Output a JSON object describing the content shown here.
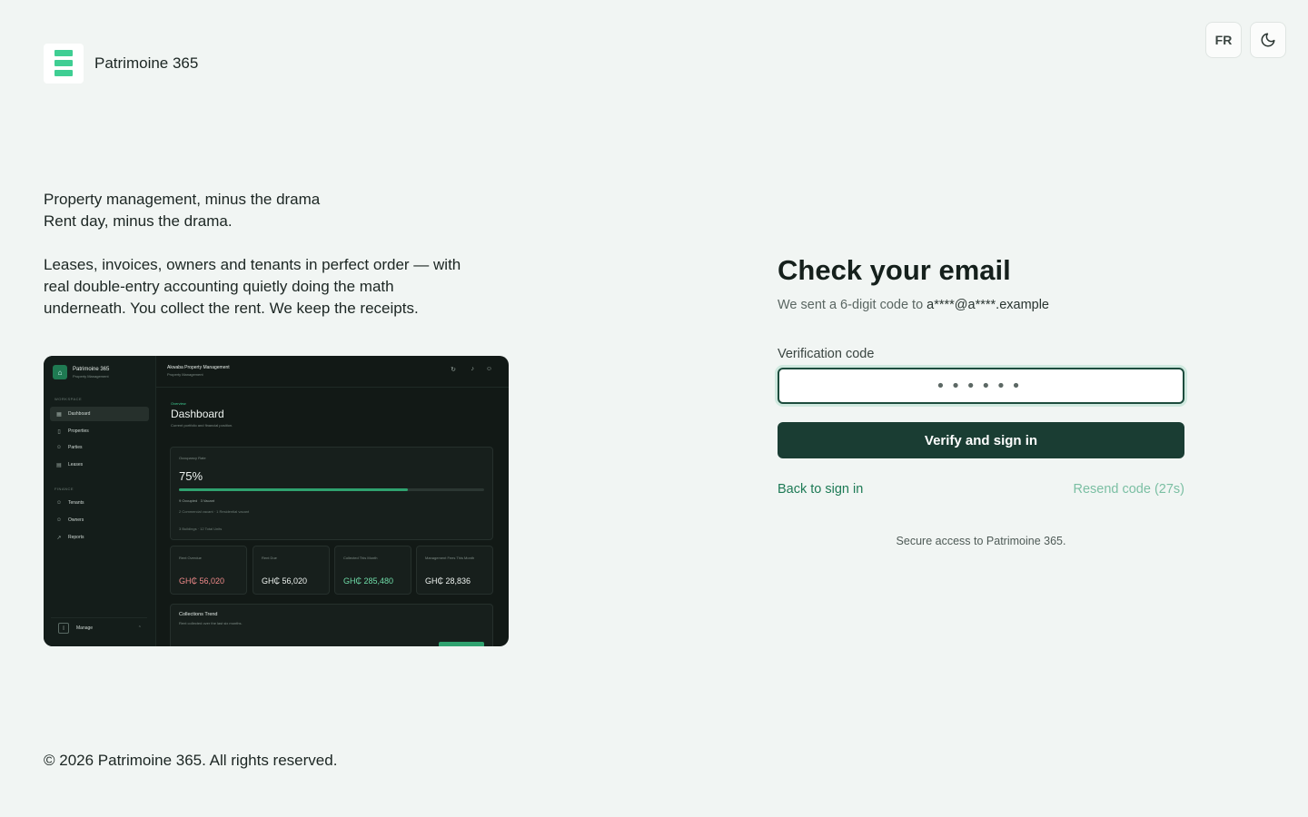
{
  "brand": {
    "name": "Patrimoine 365",
    "logo_icon": "stacked-bars-logo",
    "accent": "#3fce93"
  },
  "top_actions": {
    "lang_label": "FR",
    "theme_icon": "moon-icon"
  },
  "hero": {
    "line1": "Property management, minus the drama",
    "line2": "Rent day, minus the drama.",
    "paragraph": "Leases, invoices, owners and tenants in perfect order — with real double-entry accounting quietly doing the math underneath. You collect the rent. We keep the receipts."
  },
  "preview": {
    "app_name": "Patrimoine 365",
    "app_sub": "Property Management",
    "company": "Akwaba Property Management",
    "company_sub": "Property Management",
    "workspace_label": "WORKSPACE",
    "finance_label": "FINANCE",
    "nav": {
      "dashboard": "Dashboard",
      "properties": "Properties",
      "parties": "Parties",
      "leases": "Leases",
      "tenants": "Tenants",
      "owners": "Owners",
      "reports": "Reports"
    },
    "manage": "Manage",
    "overview": "Overview",
    "title": "Dashboard",
    "subtitle": "Current portfolio and financial position.",
    "occupancy": {
      "label": "Occupancy Rate",
      "value": "75%",
      "fill": 0.75,
      "occupied": "9 Occupied",
      "vacant": "3 Vacant",
      "detail": "2 Commercial vacant · 1 Residential vacant",
      "units": "3 Buildings · 12 Total Units"
    },
    "stats": [
      {
        "label": "Rent Overdue",
        "value": "GH₵ 56,020",
        "color": "#f08a8a"
      },
      {
        "label": "Rent Due",
        "value": "GH₵ 56,020",
        "color": "#eef3f0"
      },
      {
        "label": "Collected This Month",
        "value": "GH₵ 285,480",
        "color": "#6fdca8"
      },
      {
        "label": "Management Fees This Month",
        "value": "GH₵ 28,836",
        "color": "#eef3f0"
      }
    ],
    "trend": {
      "title": "Collections Trend",
      "subtitle": "Rent collected over the last six months."
    }
  },
  "login": {
    "title": "Check your email",
    "sent_prefix": "We sent a 6-digit code to ",
    "email": "a****@a****.example",
    "code_label": "Verification code",
    "code_placeholder": "••••••",
    "verify_label": "Verify and sign in",
    "back_label": "Back to sign in",
    "resend_label": "Resend code (27s)",
    "secure_note": "Secure access to Patrimoine 365."
  },
  "footer": {
    "copyright": "© 2026 Patrimoine 365. All rights reserved."
  }
}
